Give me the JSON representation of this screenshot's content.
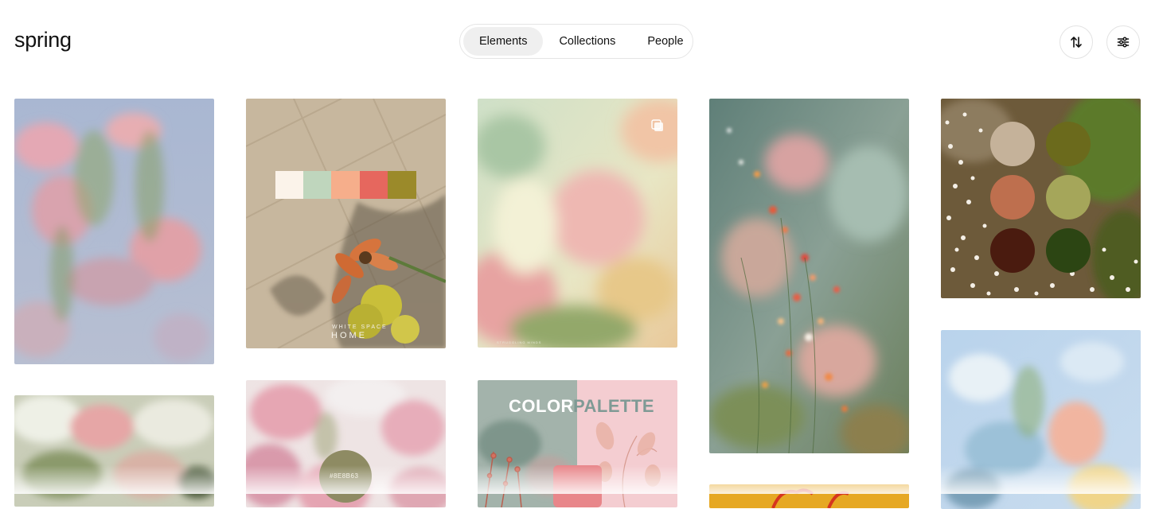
{
  "header": {
    "title": "spring",
    "tabs": [
      {
        "label": "Elements",
        "active": true
      },
      {
        "label": "Collections",
        "active": false
      },
      {
        "label": "People",
        "active": false
      }
    ],
    "sort_icon": "sort-arrows-icon",
    "filter_icon": "sliders-icon"
  },
  "grid": {
    "cards": [
      {
        "id": "blurred-pink-flowers-sky",
        "type": "image"
      },
      {
        "id": "sunlit-tiles-flowers-palette",
        "type": "palette",
        "palette": [
          "#FBF3EA",
          "#BFD6BD",
          "#F6AE8B",
          "#E6675E",
          "#9B8A2A"
        ],
        "caption_small": "WHITE SPACE",
        "caption_big": "HOME"
      },
      {
        "id": "soft-pastel-petals",
        "type": "image",
        "caption_small": "STRUGGLING MINDS"
      },
      {
        "id": "wildflowers-teal-blur",
        "type": "image"
      },
      {
        "id": "white-blossoms-palette",
        "type": "palette",
        "palette": [
          "#C5B29A",
          "#6B6A1C",
          "#BE6F4E",
          "#A5A65A",
          "#4A1B0F",
          "#2C4513"
        ]
      },
      {
        "id": "cherry-blossom-tree",
        "type": "image"
      },
      {
        "id": "pink-blossoms-swatch",
        "type": "palette",
        "swatch_label": "#8E8B63",
        "swatch_color": "#8E8B63"
      },
      {
        "id": "color-palette-card",
        "type": "palette",
        "heading_a": "COLOR",
        "heading_b": "PALETTE",
        "swatch_color": "#E8868A"
      },
      {
        "id": "yellow-card-partial",
        "type": "image"
      },
      {
        "id": "pastel-glass-flowers",
        "type": "image"
      }
    ]
  },
  "colors": {
    "accent_active_tab": "#efefef",
    "border": "#e5e5e5"
  }
}
